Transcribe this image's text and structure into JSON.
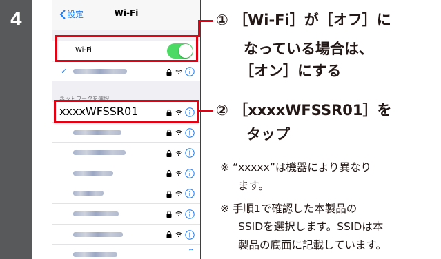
{
  "step": {
    "number": "4"
  },
  "phone": {
    "nav": {
      "back_label": "設定",
      "title": "Wi-Fi"
    },
    "wifi_row": {
      "label": "Wi-Fi",
      "toggle_on": true
    },
    "section_header": "ネットワークを選択...",
    "target_network": {
      "ssid": "xxxxWFSSR01"
    }
  },
  "instructions": {
    "step1": {
      "line1": "① ［Wi-Fi］が［オフ］に",
      "line2": "なっている場合は、",
      "line3": "［オン］にする"
    },
    "step2": {
      "line1": "② ［xxxxWFSSR01］を",
      "line2": "タップ"
    },
    "notes": {
      "note1_line1": "※ “xxxxx”は機器により異なり",
      "note1_line2": "ます。",
      "note2_line1": "※ 手順1で確認した本製品の",
      "note2_line2": "SSIDを選択します。SSIDは本",
      "note2_line3": "製品の底面に記載しています。"
    }
  },
  "colors": {
    "accent_red": "#e60012",
    "ios_blue": "#1a7cf5",
    "toggle_green": "#4cd964",
    "step_bar": "#57595b"
  }
}
